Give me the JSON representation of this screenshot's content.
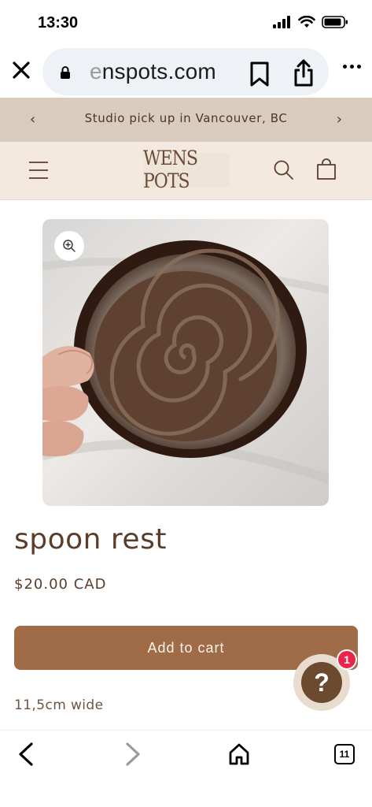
{
  "status_bar": {
    "time": "13:30",
    "icons": [
      "cellular-signal-icon",
      "wifi-icon",
      "battery-icon"
    ]
  },
  "browser": {
    "url_faded": "e",
    "url_main": "nspots.com",
    "icons": [
      "close-icon",
      "lock-icon",
      "bookmark-icon",
      "share-icon",
      "more-icon"
    ]
  },
  "announcement": {
    "text": "Studio pick up in Vancouver, BC",
    "prev_symbol": "‹",
    "next_symbol": "›"
  },
  "header": {
    "logo_text": "WENS POTS",
    "icons": [
      "menu-icon",
      "search-icon",
      "cart-icon"
    ]
  },
  "product": {
    "image_subject": "hand holding a round brown glazed ceramic spoon rest with spiral pattern",
    "zoom_icon": "zoom-in-icon",
    "title": "spoon rest",
    "price": "$20.00 CAD",
    "add_to_cart_label": "Add to cart",
    "description": "11,5cm wide"
  },
  "help_widget": {
    "symbol": "?",
    "badge_count": "1"
  },
  "bottom_toolbar": {
    "tab_count": "11",
    "icons": [
      "back-icon",
      "forward-icon",
      "home-icon",
      "tabs-icon"
    ]
  },
  "colors": {
    "announcement_bg": "#d9ccbd",
    "header_bg": "#f3e9df",
    "brand_brown": "#a06b47",
    "text_brown": "#5a3e2b",
    "badge_red": "#e8254b"
  }
}
